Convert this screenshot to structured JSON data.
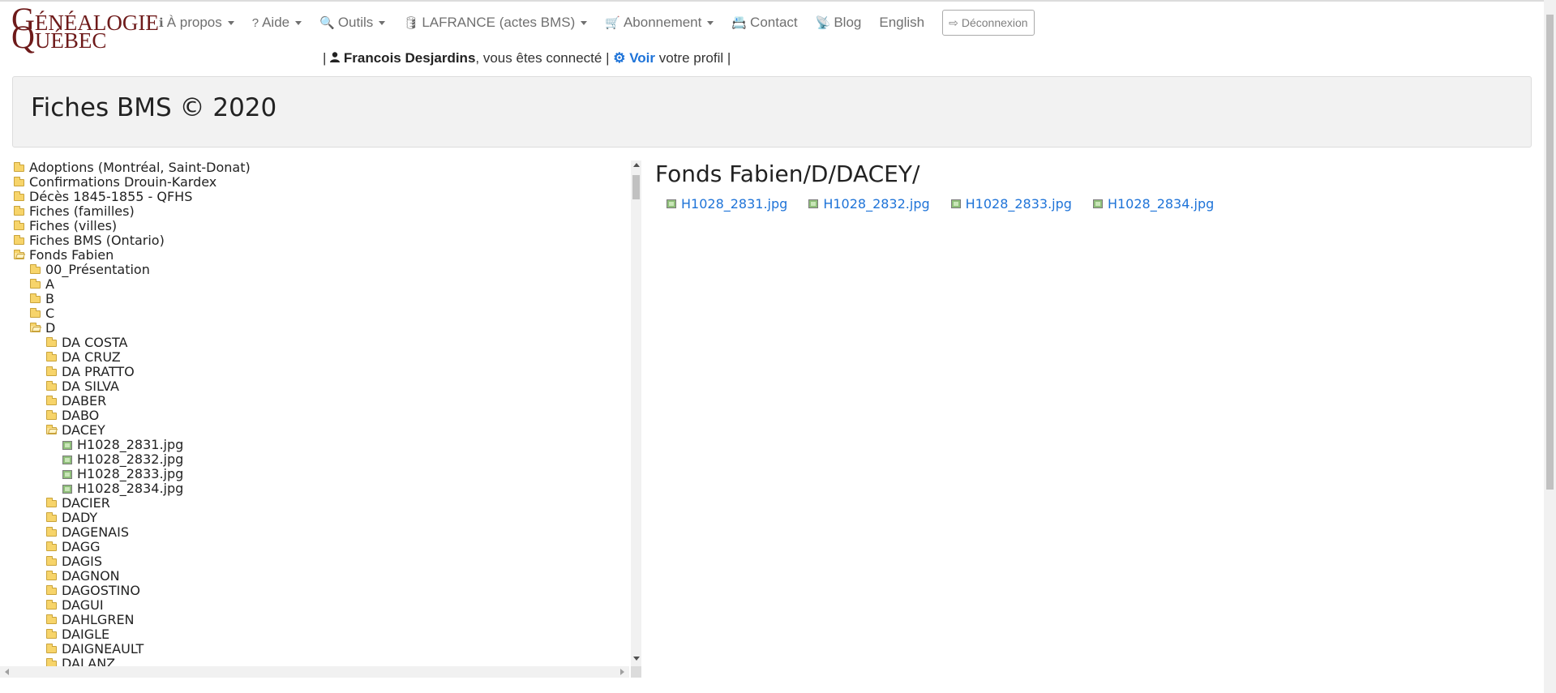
{
  "logo": {
    "line1_cap": "G",
    "line1_rest": "ÉNÉALOGIE",
    "line2_cap": "Q",
    "line2_rest": "UÉBEC"
  },
  "nav": {
    "items": [
      {
        "label": "À propos",
        "icon": "info-icon",
        "glyph": "ℹ",
        "dropdown": true
      },
      {
        "label": "Aide",
        "icon": "question-icon",
        "glyph": "?",
        "dropdown": true
      },
      {
        "label": "Outils",
        "icon": "search-icon",
        "glyph": "🔍",
        "dropdown": true
      },
      {
        "label": "LAFRANCE (actes BMS)",
        "icon": "database-icon",
        "glyph": "🛢",
        "dropdown": true
      },
      {
        "label": "Abonnement",
        "icon": "cart-icon",
        "glyph": "🛒",
        "dropdown": true
      },
      {
        "label": "Contact",
        "icon": "contact-card-icon",
        "glyph": "📇",
        "dropdown": false
      },
      {
        "label": "Blog",
        "icon": "rss-icon",
        "glyph": "📡",
        "dropdown": false
      },
      {
        "label": "English",
        "icon": "",
        "glyph": "",
        "dropdown": false
      }
    ],
    "logout_label": "Déconnexion"
  },
  "user": {
    "sep": "|",
    "name": "Francois Desjardins",
    "connected_text": ", vous êtes connecté",
    "view_label": "Voir",
    "profile_text": " votre profil"
  },
  "page": {
    "title": "Fiches BMS © 2020"
  },
  "tree": [
    {
      "label": "Adoptions (Montréal, Saint-Donat)",
      "type": "folder",
      "depth": 0
    },
    {
      "label": "Confirmations Drouin-Kardex",
      "type": "folder",
      "depth": 0
    },
    {
      "label": "Décès 1845-1855 - QFHS",
      "type": "folder",
      "depth": 0
    },
    {
      "label": "Fiches (familles)",
      "type": "folder",
      "depth": 0
    },
    {
      "label": "Fiches (villes)",
      "type": "folder",
      "depth": 0
    },
    {
      "label": "Fiches BMS (Ontario)",
      "type": "folder",
      "depth": 0
    },
    {
      "label": "Fonds Fabien",
      "type": "folder-open",
      "depth": 0
    },
    {
      "label": "00_Présentation",
      "type": "folder",
      "depth": 1
    },
    {
      "label": "A",
      "type": "folder",
      "depth": 1
    },
    {
      "label": "B",
      "type": "folder",
      "depth": 1
    },
    {
      "label": "C",
      "type": "folder",
      "depth": 1
    },
    {
      "label": "D",
      "type": "folder-open",
      "depth": 1
    },
    {
      "label": "DA COSTA",
      "type": "folder",
      "depth": 2
    },
    {
      "label": "DA CRUZ",
      "type": "folder",
      "depth": 2
    },
    {
      "label": "DA PRATTO",
      "type": "folder",
      "depth": 2
    },
    {
      "label": "DA SILVA",
      "type": "folder",
      "depth": 2
    },
    {
      "label": "DABER",
      "type": "folder",
      "depth": 2
    },
    {
      "label": "DABO",
      "type": "folder",
      "depth": 2
    },
    {
      "label": "DACEY",
      "type": "folder-open",
      "depth": 2
    },
    {
      "label": "H1028_2831.jpg",
      "type": "image",
      "depth": 3
    },
    {
      "label": "H1028_2832.jpg",
      "type": "image",
      "depth": 3
    },
    {
      "label": "H1028_2833.jpg",
      "type": "image",
      "depth": 3
    },
    {
      "label": "H1028_2834.jpg",
      "type": "image",
      "depth": 3
    },
    {
      "label": "DACIER",
      "type": "folder",
      "depth": 2
    },
    {
      "label": "DADY",
      "type": "folder",
      "depth": 2
    },
    {
      "label": "DAGENAIS",
      "type": "folder",
      "depth": 2
    },
    {
      "label": "DAGG",
      "type": "folder",
      "depth": 2
    },
    {
      "label": "DAGIS",
      "type": "folder",
      "depth": 2
    },
    {
      "label": "DAGNON",
      "type": "folder",
      "depth": 2
    },
    {
      "label": "DAGOSTINO",
      "type": "folder",
      "depth": 2
    },
    {
      "label": "DAGUI",
      "type": "folder",
      "depth": 2
    },
    {
      "label": "DAHLGREN",
      "type": "folder",
      "depth": 2
    },
    {
      "label": "DAIGLE",
      "type": "folder",
      "depth": 2
    },
    {
      "label": "DAIGNEAULT",
      "type": "folder",
      "depth": 2
    },
    {
      "label": "DALANZ",
      "type": "folder",
      "depth": 2
    }
  ],
  "content": {
    "path": "Fonds Fabien/D/DACEY/",
    "files": [
      "H1028_2831.jpg",
      "H1028_2832.jpg",
      "H1028_2833.jpg",
      "H1028_2834.jpg"
    ]
  },
  "colors": {
    "link": "#1e73d8",
    "logo": "#6e1a1a",
    "folder": "#f7d46a"
  }
}
